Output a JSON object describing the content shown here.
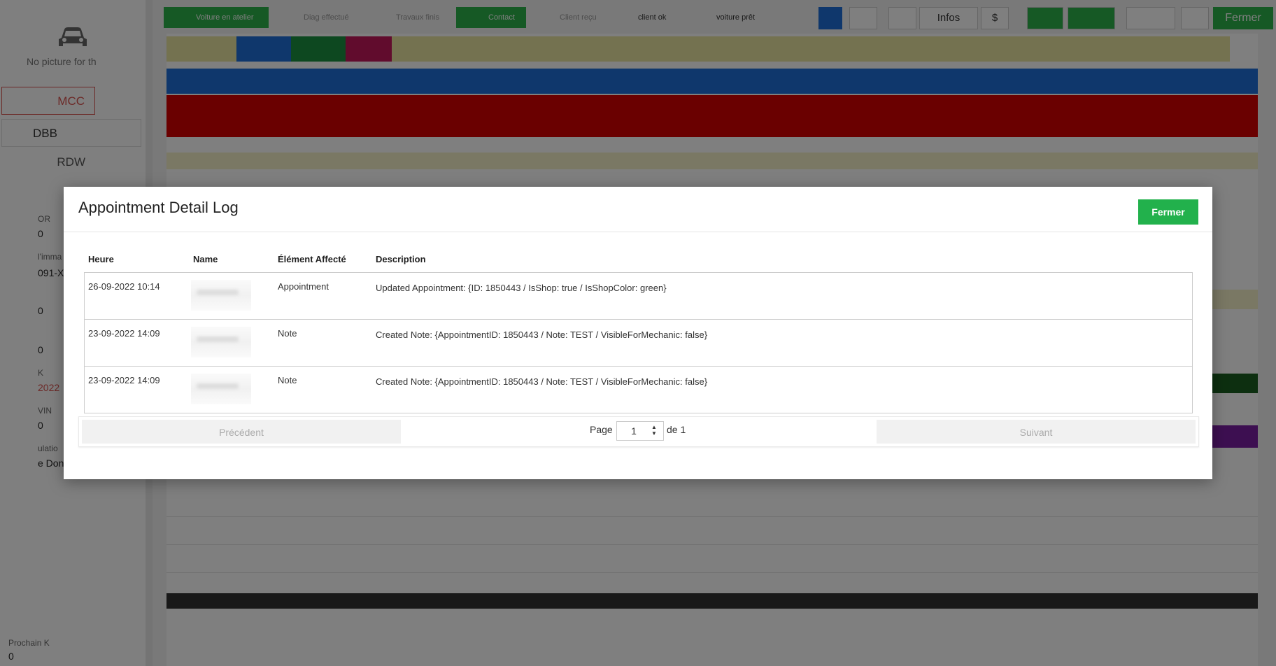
{
  "background": {
    "left_panel": {
      "no_picture_text": "No picture for th",
      "buttons": [
        "MCC",
        "DBB",
        "RDW"
      ],
      "fields": [
        {
          "label": "OR",
          "value": "0"
        },
        {
          "label": "l'imma",
          "value": "091-X"
        },
        {
          "label": "",
          "value": "0"
        },
        {
          "label": "",
          "value": "0"
        },
        {
          "label": "K",
          "value": "2022"
        },
        {
          "label": "VIN",
          "value": "0"
        },
        {
          "label": "ulatio",
          "value": "e Don"
        },
        {
          "label": "Prochain K",
          "value": "0"
        }
      ]
    },
    "topbar": {
      "steps": [
        "Voiture en atelier",
        "Diag effectué",
        "Travaux finis",
        "Contact",
        "Client reçu",
        "client ok",
        "voiture prêt"
      ],
      "infos_label": "Infos",
      "dollar_label": "$",
      "fermer_label": "Fermer"
    }
  },
  "modal": {
    "title": "Appointment Detail Log",
    "close_label": "Fermer",
    "columns": [
      "Heure",
      "Name",
      "Élément Affecté",
      "Description"
    ],
    "rows": [
      {
        "heure": "26-09-2022 10:14",
        "name": "",
        "element": "Appointment",
        "description": "Updated Appointment: {ID: 1850443 / IsShop: true / IsShopColor: green}"
      },
      {
        "heure": "23-09-2022 14:09",
        "name": "",
        "element": "Note",
        "description": "Created Note: {AppointmentID: 1850443 / Note: TEST / VisibleForMechanic: false}"
      },
      {
        "heure": "23-09-2022 14:09",
        "name": "",
        "element": "Note",
        "description": "Created Note: {AppointmentID: 1850443 / Note: TEST / VisibleForMechanic: false}"
      }
    ],
    "pagination": {
      "prev_label": "Précédent",
      "page_label": "Page",
      "current_page": "1",
      "of_label": "de 1",
      "next_label": "Suivant"
    }
  },
  "colors": {
    "primary_green": "#22b14c",
    "overlay": "rgba(0,0,0,0.5)",
    "danger": "#d9534f"
  }
}
